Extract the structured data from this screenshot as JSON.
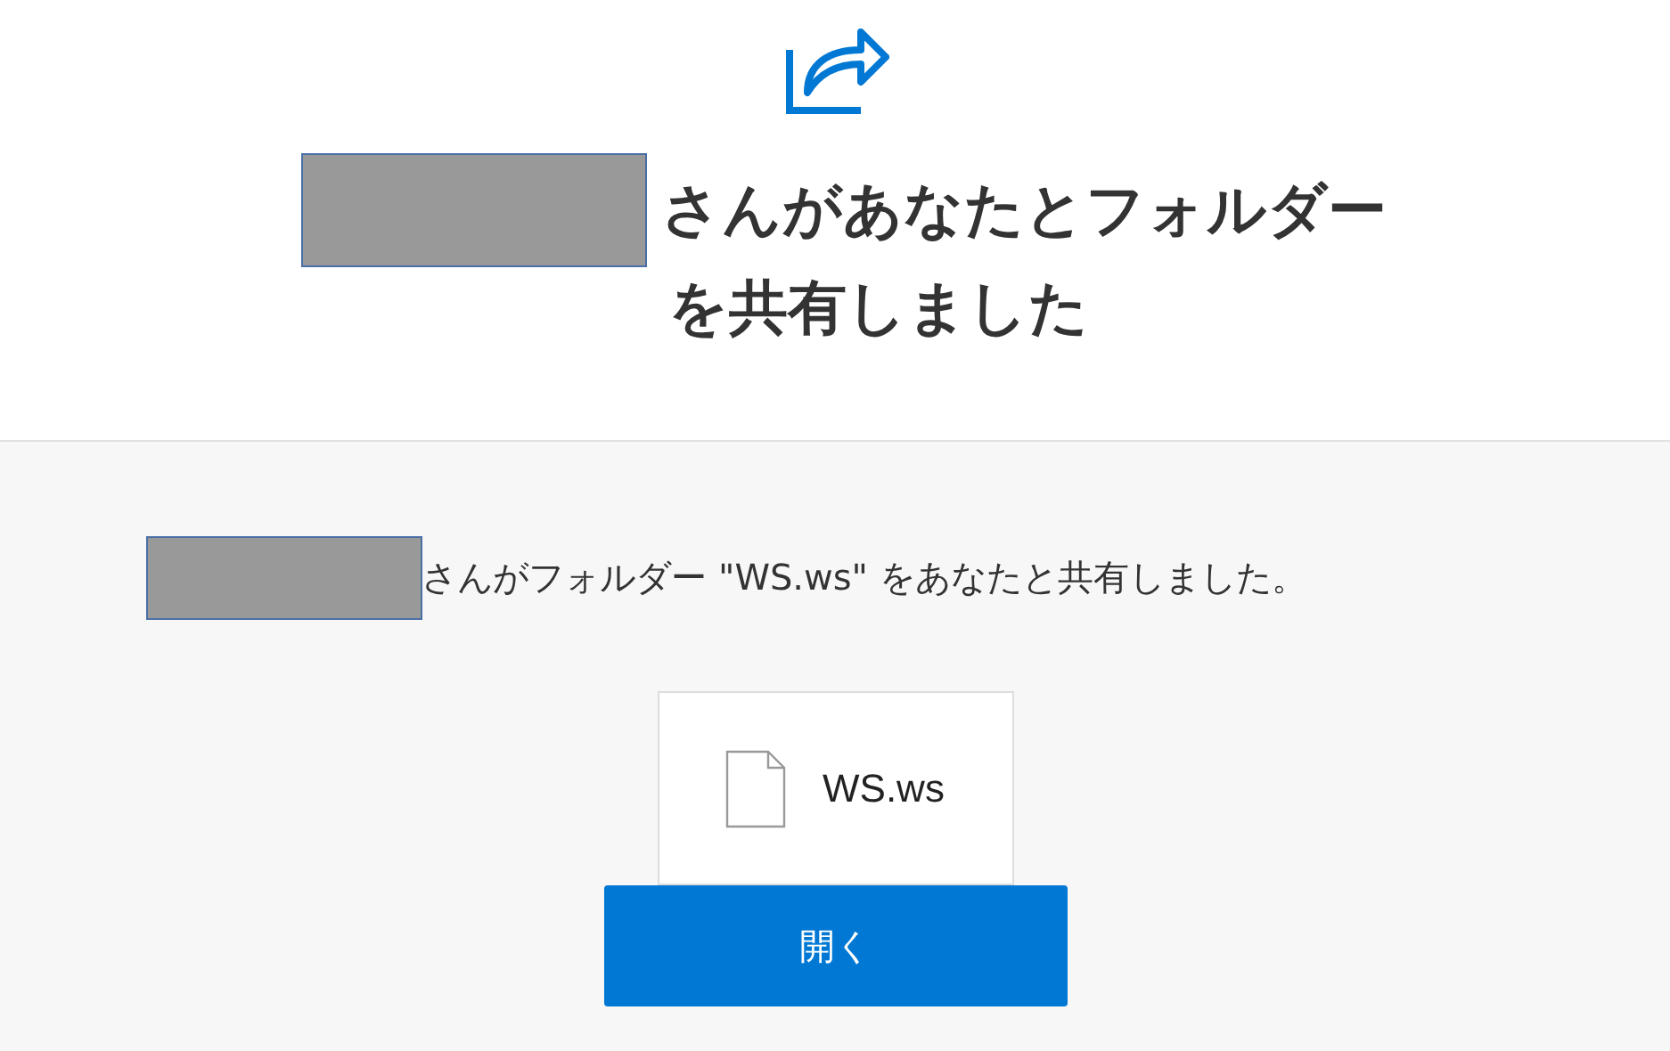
{
  "header": {
    "title_lines": [
      "さんがあなたとフォルダー",
      "を共有しました"
    ]
  },
  "body": {
    "message": "さんがフォルダー \"WS.ws\" をあなたと共有しました。",
    "file": {
      "name": "WS.ws"
    },
    "open_button": "開く"
  }
}
